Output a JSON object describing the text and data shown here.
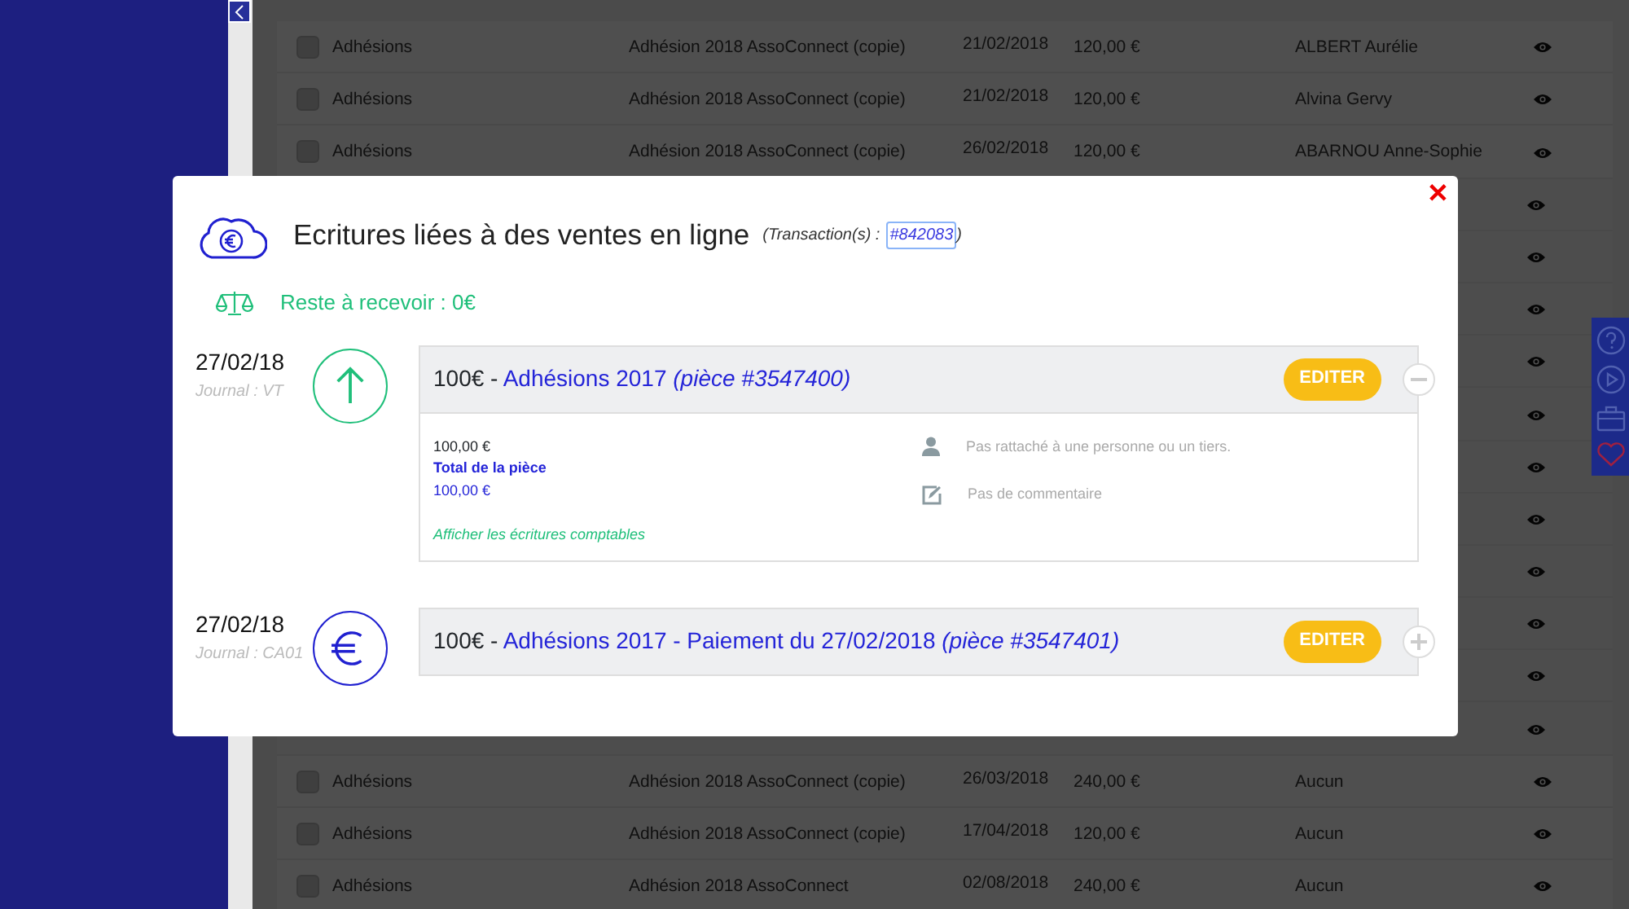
{
  "table": {
    "rows": [
      {
        "covered": false,
        "checked": false,
        "category": "Adhésions",
        "label": "Adhésion 2018 AssoConnect (copie)",
        "date": "21/02/2018",
        "amount": "120,00 €",
        "person": "ALBERT Aurélie"
      },
      {
        "covered": false,
        "checked": false,
        "category": "Adhésions",
        "label": "Adhésion 2018 AssoConnect (copie)",
        "date": "21/02/2018",
        "amount": "120,00 €",
        "person": "Alvina Gervy"
      },
      {
        "covered": false,
        "checked": false,
        "category": "Adhésions",
        "label": "Adhésion 2018 AssoConnect (copie)",
        "date": "26/02/2018",
        "amount": "120,00 €",
        "person": "ABARNOU Anne-Sophie"
      },
      {
        "covered": true
      },
      {
        "covered": true
      },
      {
        "covered": true
      },
      {
        "covered": true
      },
      {
        "covered": true
      },
      {
        "covered": true
      },
      {
        "covered": true
      },
      {
        "covered": true
      },
      {
        "covered": true
      },
      {
        "covered": true
      },
      {
        "covered": true
      },
      {
        "covered": false,
        "checked": false,
        "category": "Adhésions",
        "label": "Adhésion 2018 AssoConnect (copie)",
        "date": "26/03/2018",
        "amount": "240,00 €",
        "person": "Aucun"
      },
      {
        "covered": false,
        "checked": false,
        "category": "Adhésions",
        "label": "Adhésion 2018 AssoConnect (copie)",
        "date": "17/04/2018",
        "amount": "120,00 €",
        "person": "Aucun"
      },
      {
        "covered": false,
        "checked": false,
        "category": "Adhésions",
        "label": "Adhésion 2018 AssoConnect",
        "date": "02/08/2018",
        "amount": "240,00 €",
        "person": "Aucun"
      }
    ]
  },
  "modal": {
    "close": "✕",
    "title": "Ecritures liées à des ventes en ligne",
    "transaction_prefix": "(Transaction(s) :",
    "transaction_link": "#842083",
    "transaction_suffix": ")",
    "balance": "Reste à recevoir : 0€",
    "entries": [
      {
        "kind": "sale",
        "date": "27/02/18",
        "journal": "Journal : VT",
        "amount": "100€ -",
        "title": "Adhésions 2017",
        "piece": "(pièce #3547400)",
        "edit": "EDITER",
        "expanded": true,
        "details": {
          "amount": "100,00 €",
          "total_label": "Total de la pièce",
          "total_value": "100,00 €",
          "link": "Afficher les écritures comptables",
          "person": "Pas rattaché à une personne ou un tiers.",
          "comment": "Pas de commentaire"
        }
      },
      {
        "kind": "payment",
        "date": "27/02/18",
        "journal": "Journal : CA01",
        "amount": "100€ -",
        "title": "Adhésions 2017 - Paiement du 27/02/2018",
        "piece": "(pièce #3547401)",
        "edit": "EDITER",
        "expanded": false
      }
    ]
  }
}
